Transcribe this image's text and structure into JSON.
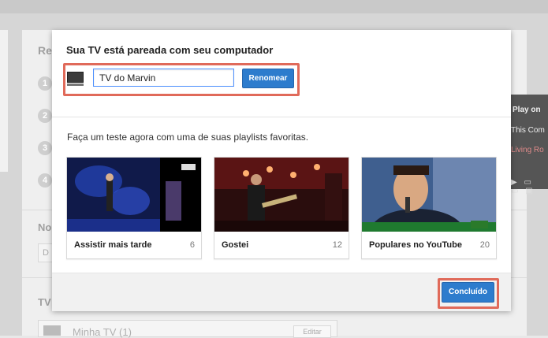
{
  "background": {
    "heading_fragment": "Re",
    "steps": [
      "1",
      "2",
      "3",
      "4"
    ],
    "notify_fragment": "No",
    "input_fragment": "D",
    "tvs_fragment": "TV",
    "video_panel": {
      "play_label": "Play on",
      "line1": "This Com",
      "line2": "Living Ro"
    },
    "my_tv_label": "Minha TV (1)",
    "edit_label": "Editar"
  },
  "modal": {
    "title": "Sua TV está pareada com seu computador",
    "tv_name_input": {
      "value": "TV do Marvin",
      "placeholder": ""
    },
    "rename_button": "Renomear",
    "subtitle": "Faça um teste agora com uma de suas playlists favoritas.",
    "playlists": [
      {
        "title": "Assistir mais tarde",
        "count": "6"
      },
      {
        "title": "Gostei",
        "count": "12"
      },
      {
        "title": "Populares no YouTube",
        "count": "20"
      }
    ],
    "done_button": "Concluído"
  },
  "colors": {
    "accent": "#2d7ccd",
    "highlight_outline": "#e06a5a"
  }
}
